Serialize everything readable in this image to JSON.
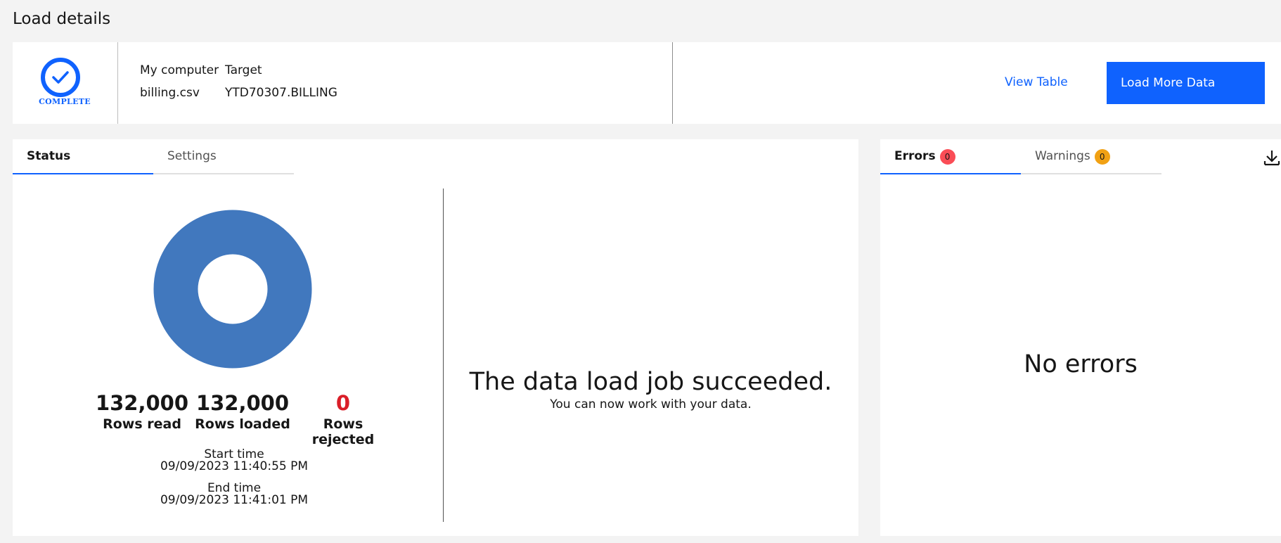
{
  "page": {
    "title": "Load details"
  },
  "summary": {
    "status_label": "COMPLETE",
    "source_header": "My computer",
    "target_header": "Target",
    "source_value": "billing.csv",
    "target_value": "YTD70307.BILLING",
    "view_table_label": "View Table",
    "load_more_label": "Load More Data"
  },
  "left_panel": {
    "tabs": [
      {
        "label": "Status",
        "active": true
      },
      {
        "label": "Settings",
        "active": false
      }
    ],
    "donut": {
      "loaded_fraction": 1.0,
      "color": "#4178be"
    },
    "stats": [
      {
        "value": "132,000",
        "label": "Rows read"
      },
      {
        "value": "132,000",
        "label": "Rows loaded"
      },
      {
        "value": "0",
        "label": "Rows rejected"
      }
    ],
    "start_label": "Start time",
    "start_value": "09/09/2023 11:40:55 PM",
    "end_label": "End time",
    "end_value": "09/09/2023 11:41:01 PM",
    "message_title": "The data load job succeeded.",
    "message_sub": "You can now work with your data."
  },
  "right_panel": {
    "tabs": [
      {
        "label": "Errors",
        "count": "0",
        "active": true
      },
      {
        "label": "Warnings",
        "count": "0",
        "active": false
      }
    ],
    "empty_message": "No errors",
    "download_icon": "download-icon"
  },
  "colors": {
    "accent": "#0f62fe",
    "error_badge": "#fa4d56",
    "warning_badge": "#f1a114",
    "rejected": "#da1e28"
  }
}
